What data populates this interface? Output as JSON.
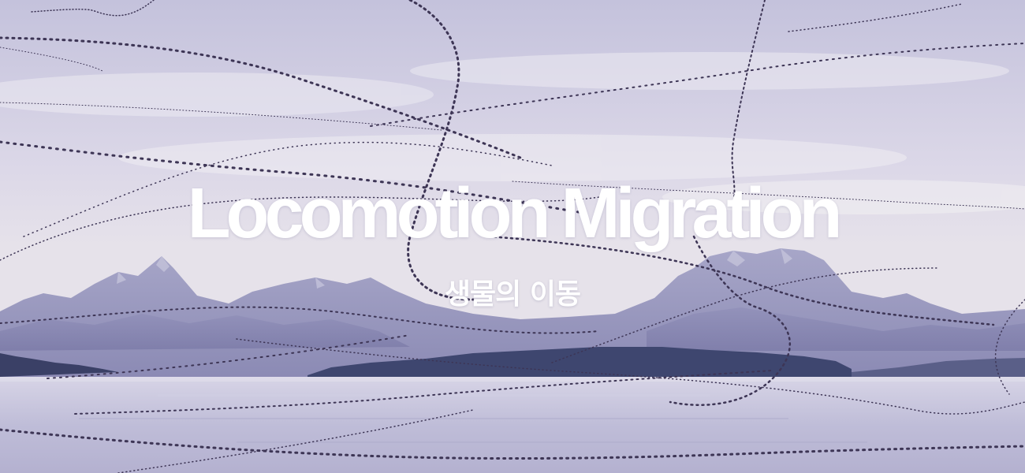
{
  "hero": {
    "title": "Locomotion Migration",
    "subtitle": "생물의 이동"
  },
  "colors": {
    "sky_top": "#c5c3dc",
    "sky_bottom": "#e3dfe8",
    "mountain": "#8f8fb8",
    "water": "#c4c3dc",
    "treeline": "#3e4670",
    "trail": "#3d3555",
    "title": "#ffffff"
  }
}
